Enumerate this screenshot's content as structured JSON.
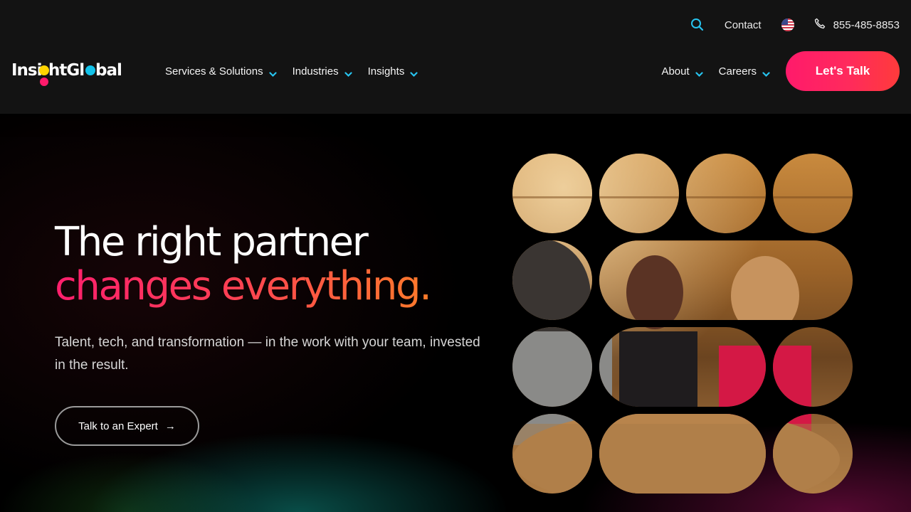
{
  "header": {
    "utility": {
      "contact_label": "Contact",
      "phone_number": "855-485-8853"
    },
    "logo": {
      "text_part1": "Insight",
      "text_part2": "Global",
      "brand_colors": [
        "#ffd400",
        "#ff1a6b",
        "#12c2e9"
      ]
    },
    "nav_left": [
      {
        "label": "Services & Solutions"
      },
      {
        "label": "Industries"
      },
      {
        "label": "Insights"
      }
    ],
    "nav_right": [
      {
        "label": "About"
      },
      {
        "label": "Careers"
      }
    ],
    "cta_label": "Let's Talk"
  },
  "hero": {
    "headline_line1": "The right partner",
    "headline_line2": "changes everything.",
    "subtext": "Talent, tech, and transformation — in the work with your team, invested in the result.",
    "button_label": "Talk to an Expert",
    "button_arrow": "→"
  },
  "colors": {
    "accent_pink": "#ff1a6b",
    "accent_orange": "#ff7b2a",
    "chevron_cyan": "#27c4ef",
    "header_bg": "#131313"
  },
  "icons": {
    "search": "search-icon",
    "flag": "us-flag-icon",
    "phone": "phone-icon",
    "chevron": "chevron-down-icon",
    "arrow": "arrow-right-icon"
  }
}
